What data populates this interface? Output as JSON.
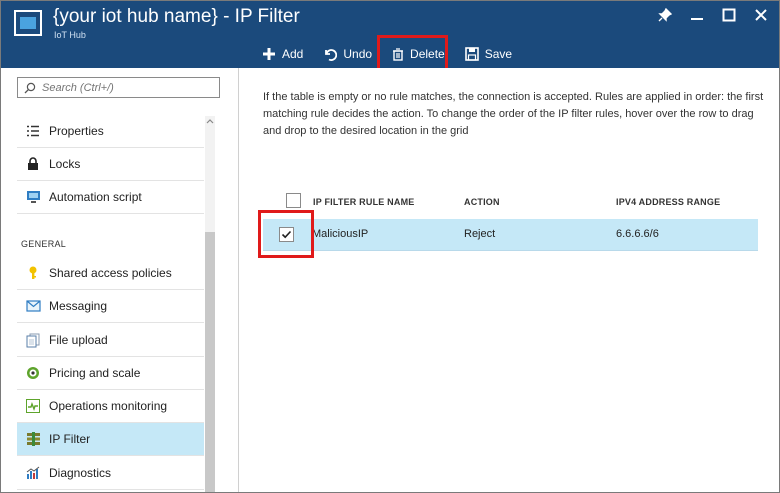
{
  "header": {
    "title": "{your iot hub name} - IP Filter",
    "subtitle": "IoT Hub"
  },
  "window_controls": [
    "pin-icon",
    "minimize-icon",
    "maximize-icon",
    "close-icon"
  ],
  "toolbar": {
    "add_label": "Add",
    "undo_label": "Undo",
    "delete_label": "Delete",
    "save_label": "Save"
  },
  "sidebar": {
    "search_placeholder": "Search (Ctrl+/)",
    "items_top": [
      {
        "label": "Properties",
        "icon": "properties-icon"
      },
      {
        "label": "Locks",
        "icon": "lock-icon"
      },
      {
        "label": "Automation script",
        "icon": "automation-script-icon"
      }
    ],
    "section_general": "GENERAL",
    "items_general": [
      {
        "label": "Shared access policies",
        "icon": "key-icon"
      },
      {
        "label": "Messaging",
        "icon": "messaging-icon"
      },
      {
        "label": "File upload",
        "icon": "file-upload-icon"
      },
      {
        "label": "Pricing and scale",
        "icon": "pricing-icon"
      },
      {
        "label": "Operations monitoring",
        "icon": "operations-monitoring-icon"
      },
      {
        "label": "IP Filter",
        "icon": "ip-filter-icon"
      },
      {
        "label": "Diagnostics",
        "icon": "diagnostics-icon"
      }
    ],
    "selected": "IP Filter"
  },
  "content": {
    "description": "If the table is empty or no rule matches, the connection is accepted. Rules are applied in order: the first matching rule decides the action. To change the order of the IP filter rules, hover over the row to drag and drop to the desired location in the grid",
    "table": {
      "columns": [
        "IP FILTER RULE NAME",
        "ACTION",
        "IPV4 ADDRESS RANGE"
      ],
      "rows": [
        {
          "checked": true,
          "name": "MaliciousIP",
          "action": "Reject",
          "range": "6.6.6.6/6"
        }
      ]
    }
  },
  "colors": {
    "header_bg": "#1b4a7c",
    "selected_bg": "#c5e8f7",
    "highlight_border": "#e01a1a"
  }
}
